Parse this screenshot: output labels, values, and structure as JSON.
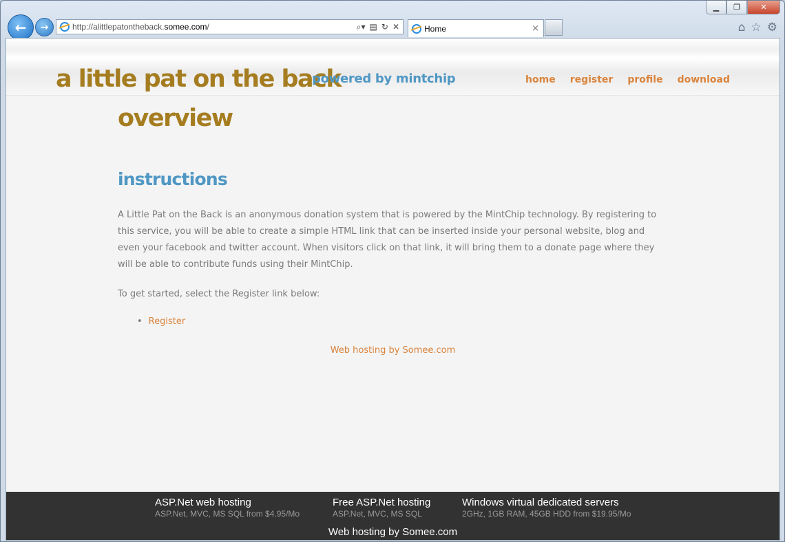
{
  "browser": {
    "url_prefix": "http://alittlepatontheback.",
    "url_domain": "somee.com",
    "url_suffix": "/",
    "tab_title": "Home",
    "tab_close": "×",
    "back_glyph": "←",
    "forward_glyph": "→",
    "minimize": "▁",
    "maximize": "❐",
    "close": "✕",
    "tools": {
      "home": "⌂",
      "favorites": "☆",
      "settings": "⚙"
    }
  },
  "site": {
    "brand": "a little pat on the back",
    "powered_by": "powered by mintchip",
    "menu": [
      "home",
      "register",
      "profile",
      "download"
    ]
  },
  "main": {
    "title": "overview",
    "section_title": "instructions",
    "paragraph1": "A Little Pat on the Back is an anonymous donation system that is powered by the MintChip technology. By registering to this service, you will be able to create a simple HTML link that can be inserted inside your personal website, blog and even your facebook and twitter account. When visitors click on that link, it will bring them to a donate page where they will be able to contribute funds using their MintChip.",
    "paragraph2": "To get started, select the Register link below:",
    "register_link": "Register",
    "hosting_link": "Web hosting by Somee.com"
  },
  "footer": {
    "columns": [
      {
        "title": "ASP.Net web hosting",
        "sub": "ASP.Net, MVC, MS SQL from $4.95/Mo"
      },
      {
        "title": "Free ASP.Net hosting",
        "sub": "ASP.Net, MVC, MS SQL"
      },
      {
        "title": "Windows virtual dedicated servers",
        "sub": "2GHz, 1GB RAM, 45GB HDD from $19.95/Mo"
      }
    ],
    "bottom": "Web hosting by Somee.com"
  },
  "colors": {
    "brand": "#a57d20",
    "accent_blue": "#4f97c4",
    "link_orange": "#d9843d",
    "footer_bg": "#323232"
  }
}
